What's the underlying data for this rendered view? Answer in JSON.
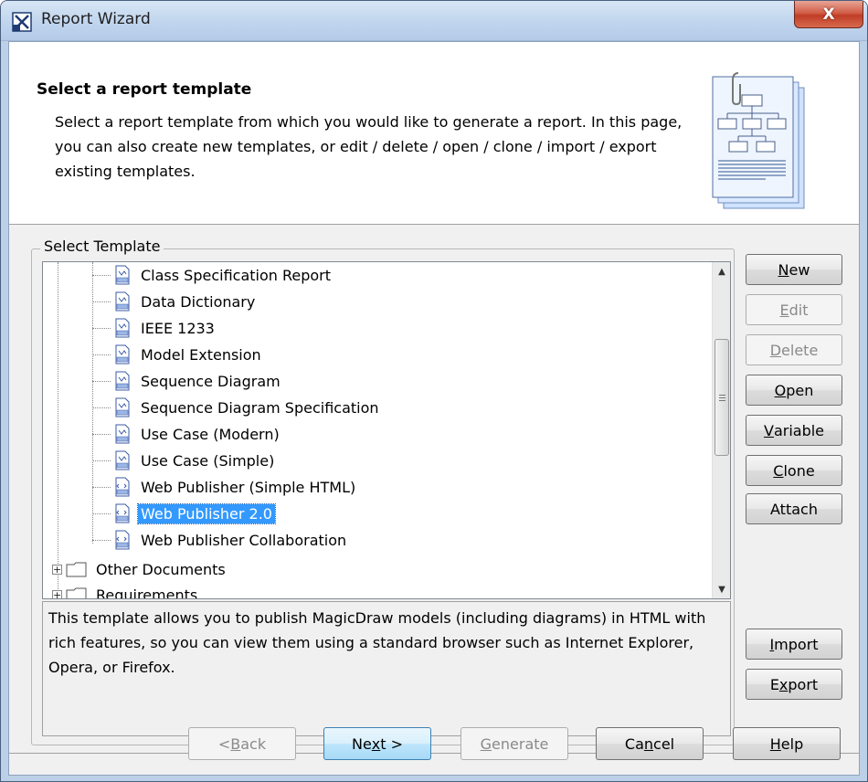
{
  "window": {
    "title": "Report Wizard",
    "close_label": "X"
  },
  "header": {
    "title": "Select a report template",
    "description": "Select a report template from which you would like to generate a report. In this page, you can also create new templates, or edit / delete / open / clone / import / export existing templates."
  },
  "select_template": {
    "group_label": "Select Template",
    "templates": [
      {
        "label": "Class Specification Report",
        "icon": "report-template-icon"
      },
      {
        "label": "Data Dictionary",
        "icon": "report-template-icon"
      },
      {
        "label": "IEEE 1233",
        "icon": "report-template-icon"
      },
      {
        "label": "Model Extension",
        "icon": "report-template-icon"
      },
      {
        "label": "Sequence Diagram",
        "icon": "report-template-icon"
      },
      {
        "label": "Sequence Diagram Specification",
        "icon": "report-template-icon"
      },
      {
        "label": "Use Case (Modern)",
        "icon": "report-template-icon"
      },
      {
        "label": "Use Case (Simple)",
        "icon": "report-template-icon"
      },
      {
        "label": "Web Publisher (Simple HTML)",
        "icon": "html-template-icon"
      },
      {
        "label": "Web Publisher 2.0",
        "icon": "html-template-icon",
        "selected": true
      },
      {
        "label": "Web Publisher Collaboration",
        "icon": "html-template-icon"
      }
    ],
    "folders": [
      {
        "label": "Other Documents",
        "expander": "+"
      },
      {
        "label": "Requirements",
        "expander": "+"
      }
    ],
    "description": "This template allows you to publish MagicDraw models (including diagrams) in HTML with rich features, so you can view them using a standard browser such as Internet Explorer, Opera, or Firefox."
  },
  "side_buttons": {
    "new": {
      "pre": "",
      "key": "N",
      "post": "ew"
    },
    "edit": {
      "pre": "",
      "key": "E",
      "post": "dit"
    },
    "delete": {
      "pre": "",
      "key": "D",
      "post": "elete"
    },
    "open": {
      "pre": "",
      "key": "O",
      "post": "pen"
    },
    "variable": {
      "pre": "",
      "key": "V",
      "post": "ariable"
    },
    "clone": {
      "pre": "",
      "key": "C",
      "post": "lone"
    },
    "attach": {
      "pre": "Attach",
      "key": "",
      "post": ""
    },
    "import": {
      "pre": "",
      "key": "I",
      "post": "mport"
    },
    "export": {
      "pre": "E",
      "key": "x",
      "post": "port"
    }
  },
  "footer_buttons": {
    "back": {
      "pre": "< ",
      "key": "B",
      "post": "ack"
    },
    "next": {
      "pre": "Ne",
      "key": "x",
      "post": "t >"
    },
    "generate": {
      "pre": "",
      "key": "G",
      "post": "enerate"
    },
    "cancel": {
      "pre": "Ca",
      "key": "n",
      "post": "cel"
    },
    "help": {
      "pre": "",
      "key": "H",
      "post": "elp"
    }
  },
  "colors": {
    "selection": "#3399ff",
    "titlebar": "#c2d6ee",
    "close_button": "#c03d26"
  }
}
